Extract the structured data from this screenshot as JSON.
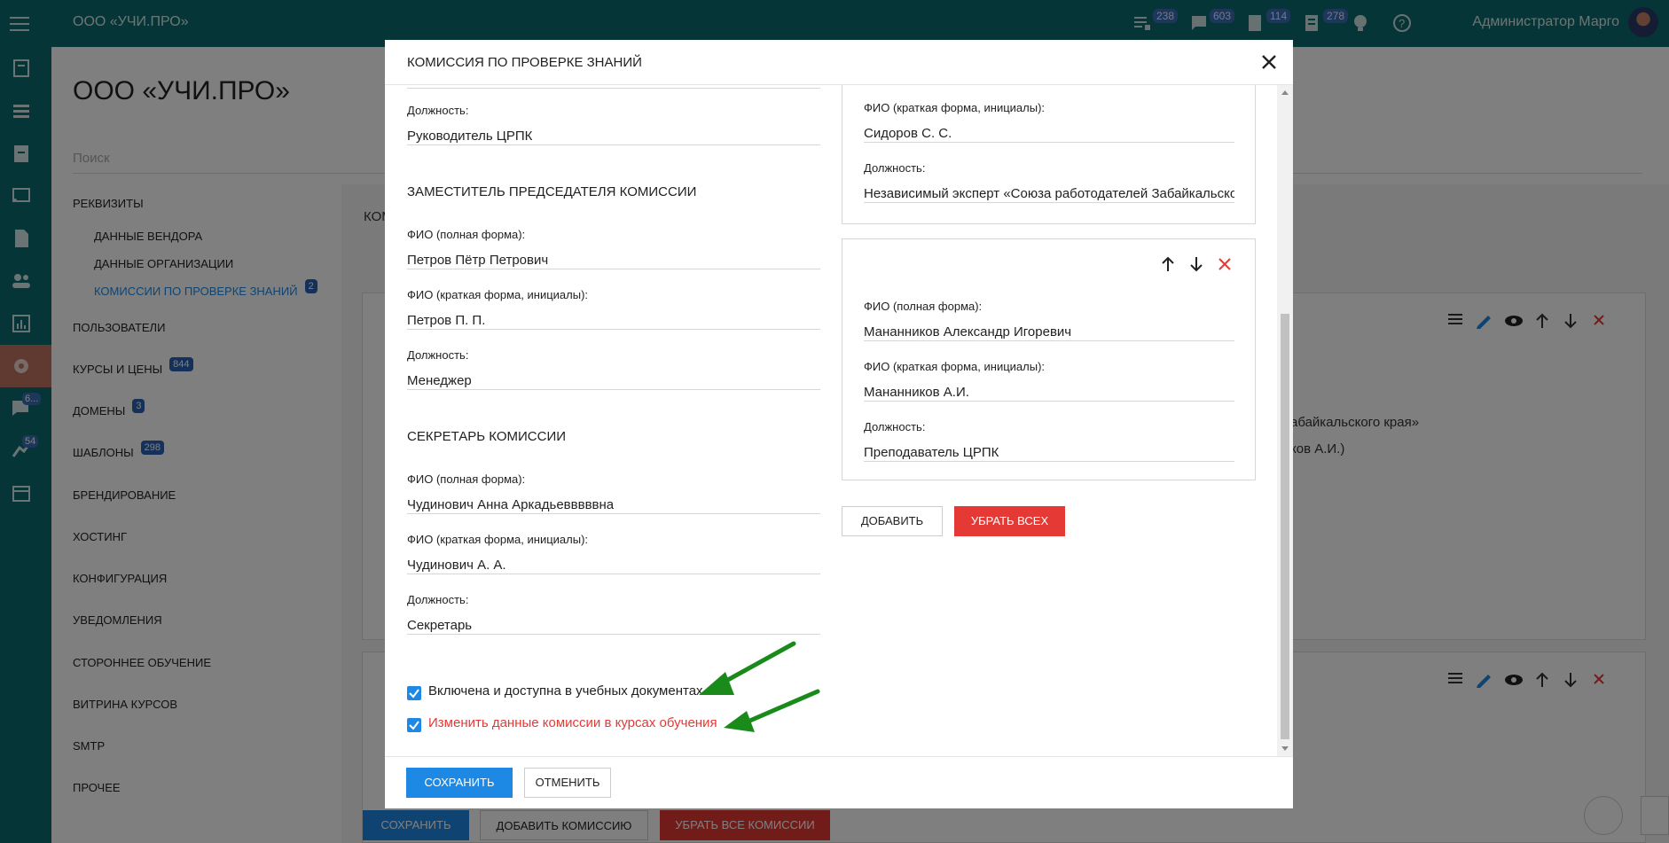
{
  "topbar": {
    "brand": "ООО «УЧИ.ПРО»",
    "badges": [
      "238",
      "603",
      "114",
      "278"
    ],
    "user": "Администратор Марго"
  },
  "sidebar": {
    "badges": [
      "6...",
      "54"
    ]
  },
  "page": {
    "title": "ООО «УЧИ.ПРО»",
    "search_placeholder": "Поиск"
  },
  "menu": {
    "items": [
      {
        "label": "РЕКВИЗИТЫ"
      },
      {
        "label": "ДАННЫЕ ВЕНДОРА"
      },
      {
        "label": "ДАННЫЕ ОРГАНИЗАЦИИ"
      },
      {
        "label": "КОМИССИИ ПО ПРОВЕРКЕ ЗНАНИЙ",
        "badge": "2"
      },
      {
        "label": "ПОЛЬЗОВАТЕЛИ"
      },
      {
        "label": "КУРСЫ И ЦЕНЫ",
        "badge": "844"
      },
      {
        "label": "ДОМЕНЫ",
        "badge": "3"
      },
      {
        "label": "ШАБЛОНЫ",
        "badge": "298"
      },
      {
        "label": "БРЕНДИРОВАНИЕ"
      },
      {
        "label": "ХОСТИНГ"
      },
      {
        "label": "КОНФИГУРАЦИЯ"
      },
      {
        "label": "УВЕДОМЛЕНИЯ"
      },
      {
        "label": "СТОРОННЕЕ ОБУЧЕНИЕ"
      },
      {
        "label": "ВИТРИНА КУРСОВ"
      },
      {
        "label": "SMTP"
      },
      {
        "label": "ПРОЧЕЕ"
      }
    ]
  },
  "background": {
    "panel_title": "КОМ",
    "text1": "абайкальского края»",
    "text2": "ков А.И.)",
    "save_label": "СОХРАНИТЬ",
    "add_label": "ДОБАВИТЬ КОМИССИЮ",
    "remove_all_label": "УБРАТЬ ВСЕ КОМИССИИ"
  },
  "modal": {
    "title": "КОМИССИЯ ПО ПРОВЕРКЕ ЗНАНИЙ",
    "left": {
      "chair_position_label": "Должность:",
      "chair_position": "Руководитель ЦРПК",
      "deputy_heading": "ЗАМЕСТИТЕЛЬ ПРЕДСЕДАТЕЛЯ КОМИССИИ",
      "deputy": {
        "full_label": "ФИО (полная форма):",
        "full": "Петров Пётр Петрович",
        "short_label": "ФИО (краткая форма, инициалы):",
        "short": "Петров П. П.",
        "position_label": "Должность:",
        "position": "Менеджер"
      },
      "secretary_heading": "СЕКРЕТАРЬ КОМИССИИ",
      "secretary": {
        "full_label": "ФИО (полная форма):",
        "full": "Чудинович Анна Аркадьевввввна",
        "short_label": "ФИО (краткая форма, инициалы):",
        "short": "Чудинович А. А.",
        "position_label": "Должность:",
        "position": "Секретарь"
      },
      "checkbox_enabled_label": "Включена и доступна в учебных документах",
      "checkbox_update_label": "Изменить данные комиссии в курсах обучения"
    },
    "right": {
      "member1": {
        "short_label": "ФИО (краткая форма, инициалы):",
        "short": "Сидоров С. С.",
        "position_label": "Должность:",
        "position": "Независимый эксперт «Союза работодателей Забайкальского"
      },
      "member2": {
        "full_label": "ФИО (полная форма):",
        "full": "Мананников Александр Игоревич",
        "short_label": "ФИО (краткая форма, инициалы):",
        "short": "Мананников А.И.",
        "position_label": "Должность:",
        "position": "Преподаватель ЦРПК"
      },
      "add_label": "ДОБАВИТЬ",
      "remove_all_label": "УБРАТЬ ВСЕХ"
    },
    "save_label": "СОХРАНИТЬ",
    "cancel_label": "ОТМЕНИТЬ"
  },
  "colors": {
    "topbar": "#0d6b6e",
    "primary": "#1e88e5",
    "danger": "#e53935",
    "arrow": "#1a8a1a"
  }
}
